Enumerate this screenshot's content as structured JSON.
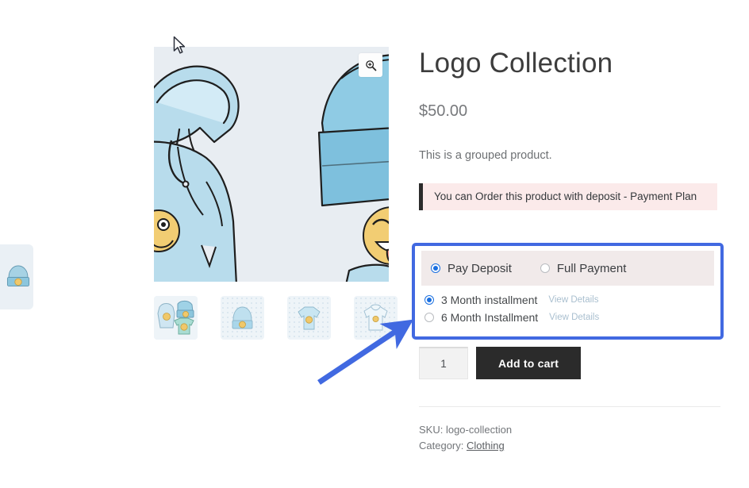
{
  "product": {
    "title": "Logo Collection",
    "price": "$50.00",
    "short_description": "This is a grouped product.",
    "notice": "You can Order this product with deposit - Payment Plan",
    "sku_line": "SKU: logo-collection",
    "category_prefix": "Category: ",
    "category_link": "Clothing"
  },
  "gallery": {
    "zoom_icon": "magnifier-plus-icon",
    "main_image_alt": "light blue hoodie and beanie illustration with emoji faces",
    "thumbnails": [
      {
        "alt": "group of hoodie beanie and t-shirt"
      },
      {
        "alt": "blue beanie"
      },
      {
        "alt": "blue t-shirt"
      },
      {
        "alt": "white hoodie"
      }
    ],
    "edge_card_alt": "blue beanie thumbnail"
  },
  "payment": {
    "mode_options": [
      {
        "label": "Pay Deposit",
        "selected": true
      },
      {
        "label": "Full Payment",
        "selected": false
      }
    ],
    "plan_options": [
      {
        "label": "3 Month installment",
        "details_label": "View Details",
        "selected": true
      },
      {
        "label": "6 Month Installment",
        "details_label": "View Details",
        "selected": false
      }
    ]
  },
  "cart": {
    "quantity": "1",
    "add_to_cart_label": "Add to cart"
  },
  "colors": {
    "highlight_border": "#4169e1",
    "arrow": "#4169e1",
    "notice_bg": "#fbeaea",
    "notice_bar": "#2b2b2b",
    "button_bg": "#2b2b2b",
    "radio_selected": "#1a6fe0",
    "pay_head_bg": "#f1eaea",
    "image_bg": "#e8edf2"
  }
}
